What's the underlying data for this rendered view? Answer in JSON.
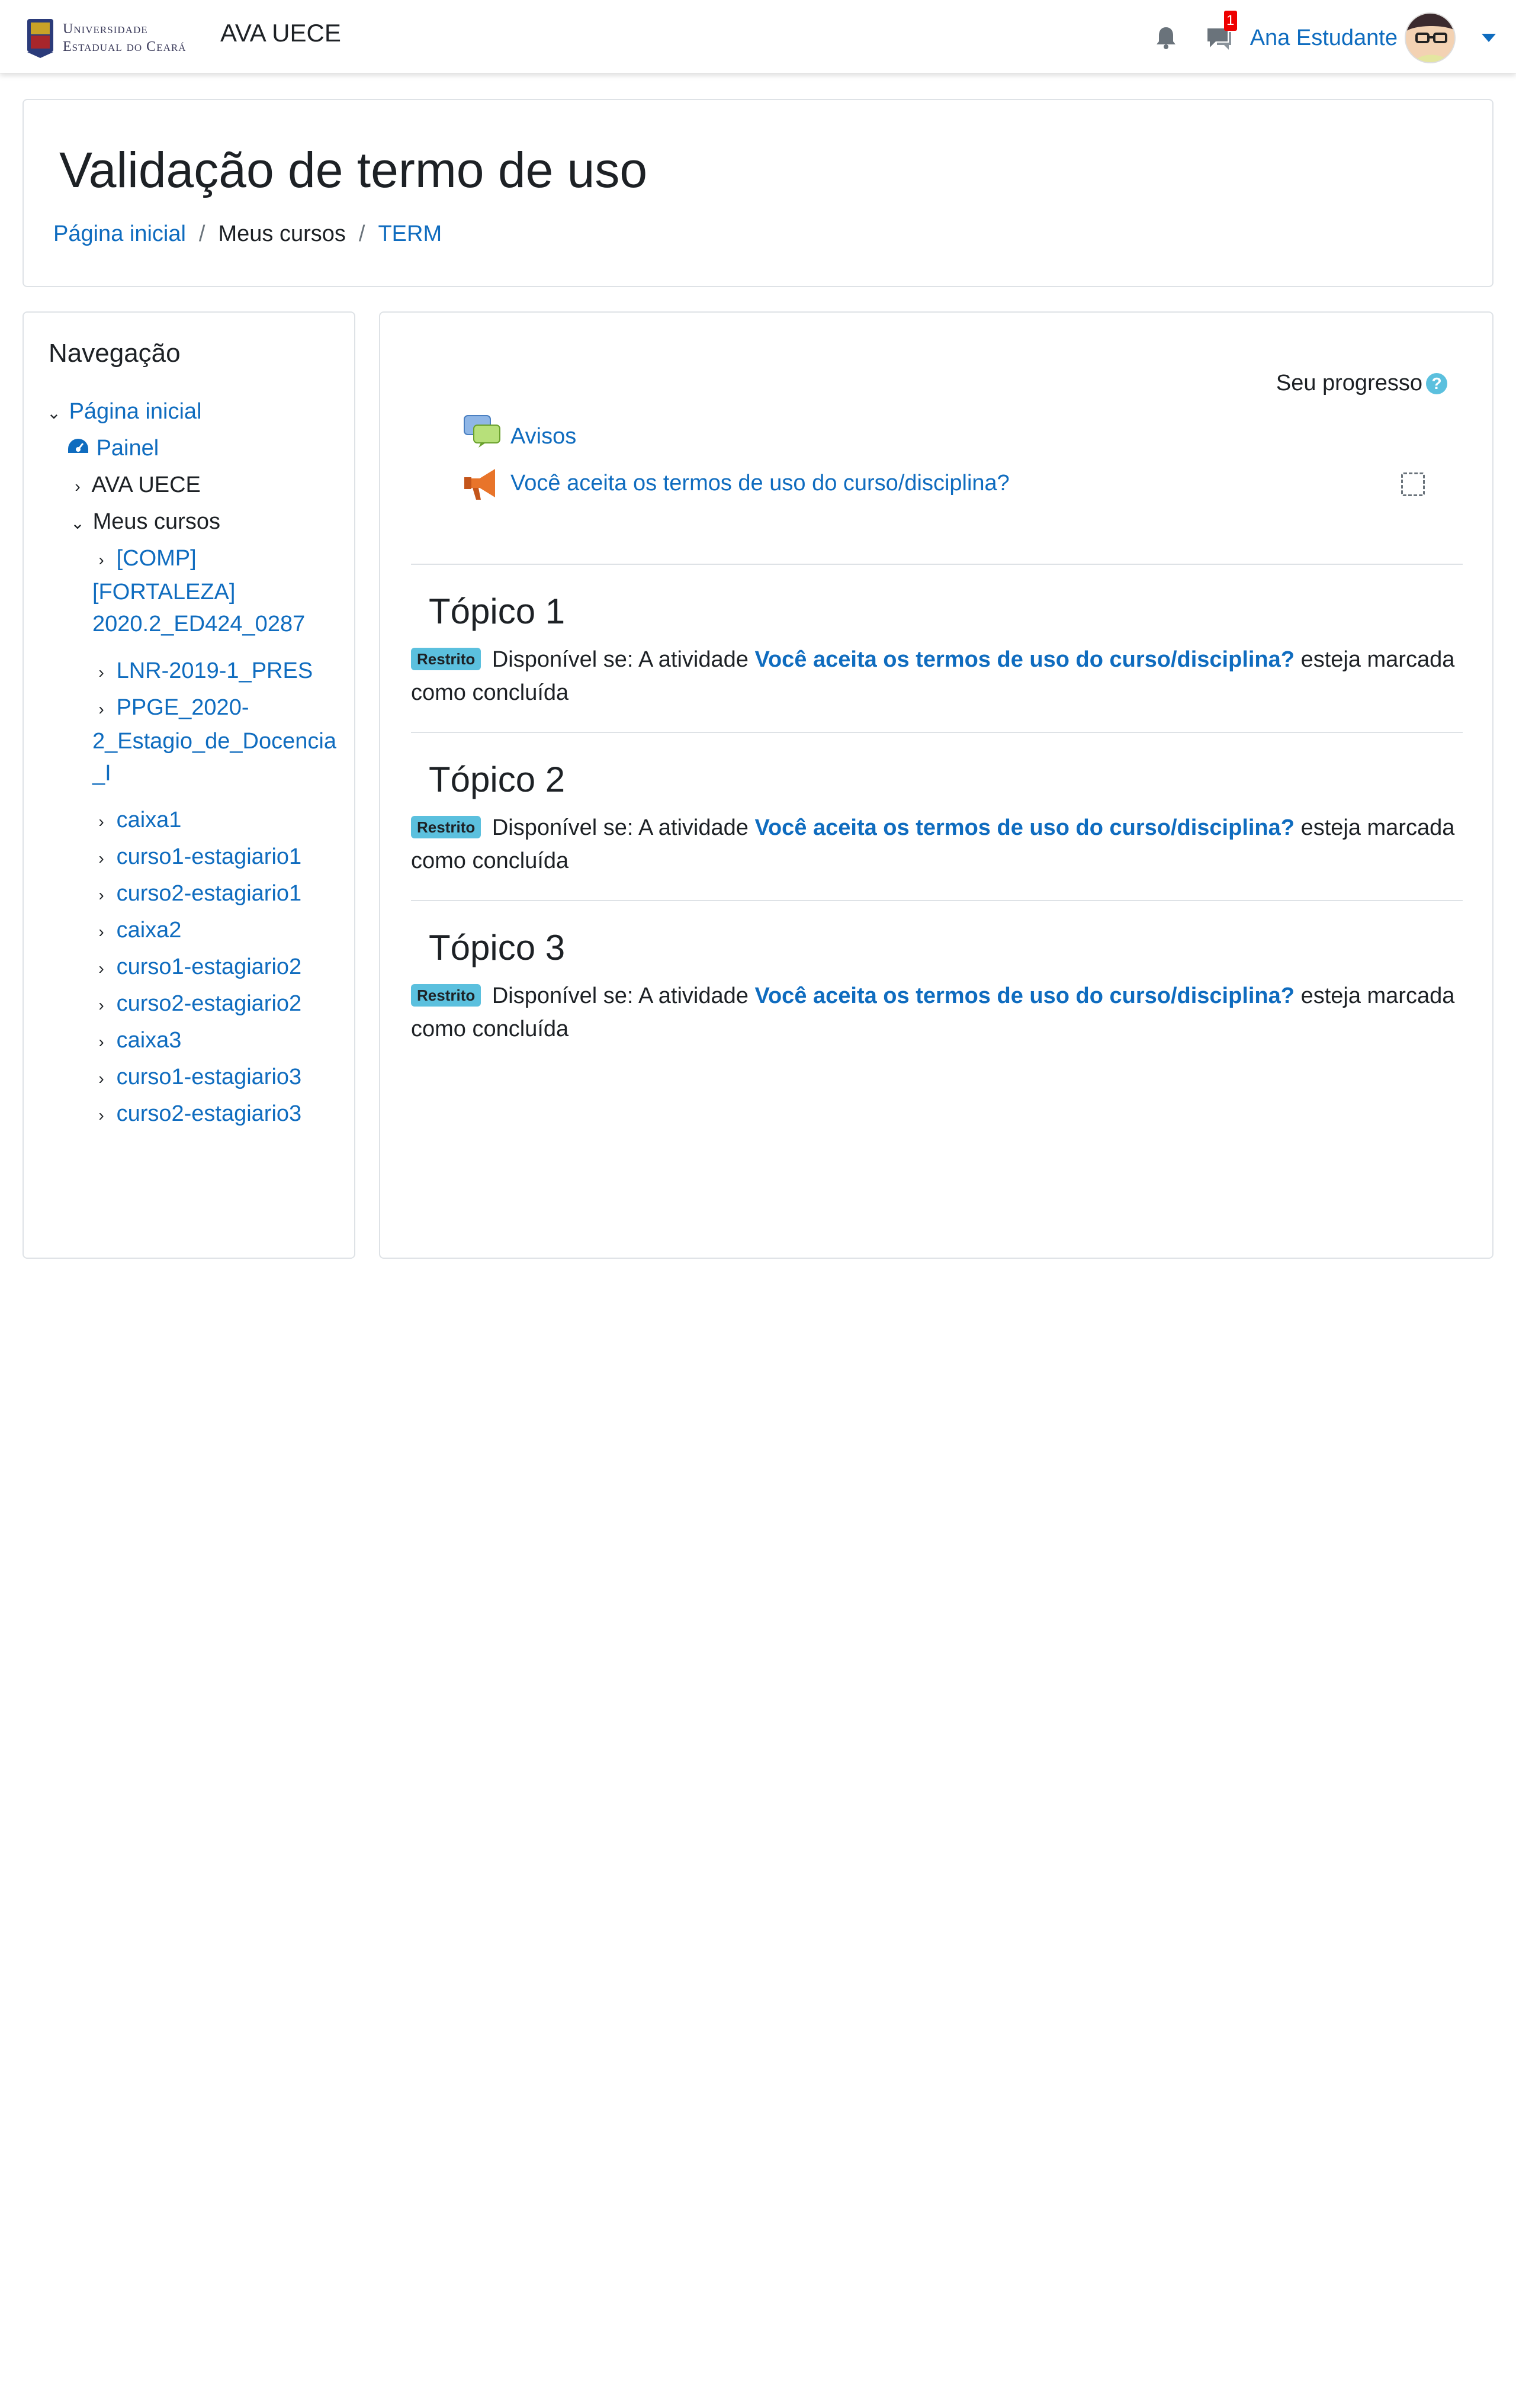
{
  "navbar": {
    "logo_line1": "Universidade",
    "logo_line2": "Estadual do Ceará",
    "site_name": "AVA UECE",
    "notifications_icon": "bell-icon",
    "messages_icon": "chat-icon",
    "messages_badge": "1",
    "user_name": "Ana Estudante"
  },
  "header": {
    "title": "Validação de termo de uso",
    "breadcrumb": [
      "Página inicial",
      "Meus cursos",
      "TERM"
    ],
    "breadcrumb_sep": "/"
  },
  "navigation": {
    "title": "Navegação",
    "items": [
      {
        "label": "Página inicial",
        "icon": "chevron-down-icon"
      },
      {
        "label": "Painel",
        "icon": "dashboard-icon"
      },
      {
        "label": "AVA UECE",
        "icon": "chevron-right-icon"
      },
      {
        "label": "Meus cursos",
        "icon": "chevron-down-icon"
      },
      {
        "label": "[COMP]",
        "label2": "[FORTALEZA]",
        "label3": "2020.2_ED424_0287"
      },
      {
        "label": "LNR-2019-1_PRES"
      },
      {
        "label": "PPGE_2020-",
        "label2": "2_Estagio_de_Docencia",
        "label3": "_I"
      },
      {
        "label": "caixa1"
      },
      {
        "label": "curso1-estagiario1"
      },
      {
        "label": "curso2-estagiario1"
      },
      {
        "label": "caixa2"
      },
      {
        "label": "curso1-estagiario2"
      },
      {
        "label": "curso2-estagiario2"
      },
      {
        "label": "caixa3"
      },
      {
        "label": "curso1-estagiario3"
      },
      {
        "label": "curso2-estagiario3"
      }
    ]
  },
  "main": {
    "progress_label": "Seu progresso",
    "help": "?",
    "activities": [
      {
        "label": "Avisos",
        "icon": "forum-icon"
      },
      {
        "label": "Você aceita os termos de uso do curso/disciplina?",
        "icon": "megaphone-icon"
      }
    ],
    "topics": [
      {
        "title": "Tópico 1"
      },
      {
        "title": "Tópico 2"
      },
      {
        "title": "Tópico 3"
      }
    ],
    "restriction": {
      "badge": "Restrito",
      "prefix": "Disponível se: A atividade",
      "activity": "Você aceita os termos de uso do curso/disciplina?",
      "suffix": "esteja marcada como concluída"
    }
  },
  "colors": {
    "link": "#0f6cbf",
    "badge_info": "#5bc0de",
    "notification_badge": "#e00000"
  }
}
